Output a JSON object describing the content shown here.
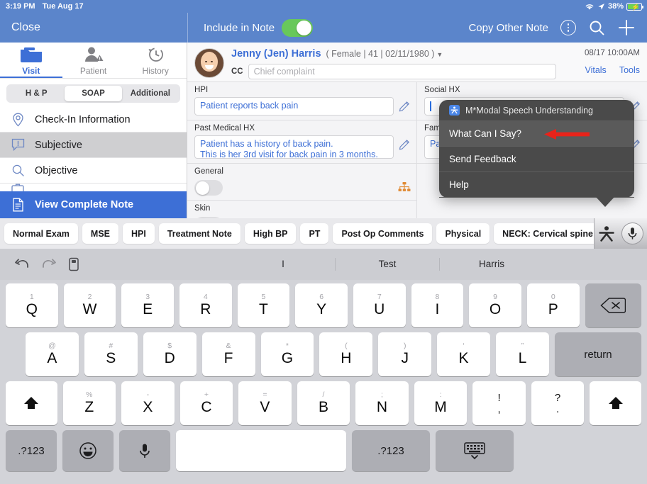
{
  "status_bar": {
    "time": "3:19 PM",
    "date": "Tue Aug 17",
    "battery_percent": "38%",
    "wifi_icon": "wifi-icon",
    "location_icon": "location-arrow-icon",
    "battery_icon": "battery-charging-icon"
  },
  "topbar": {
    "close_label": "Close",
    "include_label": "Include in Note",
    "include_toggle_on": true,
    "copy_other_note_label": "Copy Other Note",
    "more_icon": "more-vertical-circle-icon",
    "search_icon": "search-icon",
    "add_icon": "plus-icon",
    "accent_color": "#5b85cb",
    "toggle_on_color": "#68c85a"
  },
  "sidebar": {
    "tabs": [
      {
        "label": "Visit",
        "icon": "folder-icon",
        "active": true
      },
      {
        "label": "Patient",
        "icon": "person-alert-icon",
        "active": false
      },
      {
        "label": "History",
        "icon": "clock-rewind-icon",
        "active": false
      }
    ],
    "pills": [
      {
        "label": "H & P",
        "active": false
      },
      {
        "label": "SOAP",
        "active": true
      },
      {
        "label": "Additional",
        "active": false
      }
    ],
    "items": [
      {
        "label": "Check-In Information",
        "icon": "map-pin-icon",
        "state": "normal"
      },
      {
        "label": "Subjective",
        "icon": "alert-bubble-icon",
        "state": "selected"
      },
      {
        "label": "Objective",
        "icon": "magnifier-icon",
        "state": "normal"
      },
      {
        "label": "View Complete Note",
        "icon": "document-icon",
        "state": "highlighted"
      }
    ]
  },
  "patient": {
    "name": "Jenny (Jen) Harris",
    "demographics": "( Female | 41 | 02/11/1980 )",
    "caret_icon": "chevron-down-icon",
    "avatar_icon": "patient-avatar",
    "cc_label": "CC",
    "cc_value": "",
    "cc_placeholder": "Chief complaint",
    "appointment": "08/17 10:00AM",
    "vitals_label": "Vitals",
    "tools_label": "Tools"
  },
  "note_fields": {
    "left": [
      {
        "label": "HPI",
        "value": "Patient reports back pain",
        "edit_icon": "pencil-icon"
      },
      {
        "label": "Past Medical HX",
        "value": "Patient has a history of back pain.\nThis is her 3rd visit for back pain in 3 months.",
        "edit_icon": "pencil-icon"
      },
      {
        "label": "General",
        "control": "toggle-off",
        "extra_icon": "hierarchy-icon"
      },
      {
        "label": "Skin",
        "control": "toggle-off",
        "extra_icon": "hierarchy-icon"
      }
    ],
    "right": [
      {
        "label": "Social HX",
        "value": "",
        "edit_icon": "pencil-icon",
        "focused": true
      },
      {
        "label": "Family HX",
        "value": "Patient",
        "edit_icon": "pencil-icon"
      }
    ]
  },
  "popup": {
    "title": "M*Modal Speech Understanding",
    "badge_icon": "mmodal-logo-icon",
    "items": [
      {
        "label": "What Can I Say?",
        "highlighted": true
      },
      {
        "label": "Send Feedback",
        "highlighted": false
      },
      {
        "label": "Help",
        "highlighted": false
      }
    ],
    "annotation_icon": "red-arrow-annotation",
    "background_color": "#4a4a4a"
  },
  "macro_bar": {
    "buttons": [
      "Normal Exam",
      "MSE",
      "HPI",
      "Treatment Note",
      "High BP",
      "PT",
      "Post Op Comments",
      "Physical",
      "NECK: Cervical spine range of mo"
    ],
    "mmodal_icon": "mmodal-logo-icon",
    "mic_icon": "microphone-icon"
  },
  "predictive_bar": {
    "undo_icon": "undo-icon",
    "redo_icon": "redo-icon",
    "paste_icon": "clipboard-icon",
    "suggestions": [
      "I",
      "Test",
      "Harris"
    ]
  },
  "keyboard": {
    "row1": [
      {
        "alt": "1",
        "main": "Q"
      },
      {
        "alt": "2",
        "main": "W"
      },
      {
        "alt": "3",
        "main": "E"
      },
      {
        "alt": "4",
        "main": "R"
      },
      {
        "alt": "5",
        "main": "T"
      },
      {
        "alt": "6",
        "main": "Y"
      },
      {
        "alt": "7",
        "main": "U"
      },
      {
        "alt": "8",
        "main": "I"
      },
      {
        "alt": "9",
        "main": "O"
      },
      {
        "alt": "0",
        "main": "P"
      }
    ],
    "backspace_icon": "backspace-icon",
    "row2": [
      {
        "alt": "@",
        "main": "A"
      },
      {
        "alt": "#",
        "main": "S"
      },
      {
        "alt": "$",
        "main": "D"
      },
      {
        "alt": "&",
        "main": "F"
      },
      {
        "alt": "*",
        "main": "G"
      },
      {
        "alt": "(",
        "main": "H"
      },
      {
        "alt": ")",
        "main": "J"
      },
      {
        "alt": "‘",
        "main": "K"
      },
      {
        "alt": "”",
        "main": "L"
      }
    ],
    "return_label": "return",
    "row3": [
      {
        "alt": "%",
        "main": "Z"
      },
      {
        "alt": "-",
        "main": "X"
      },
      {
        "alt": "+",
        "main": "C"
      },
      {
        "alt": "=",
        "main": "V"
      },
      {
        "alt": "/",
        "main": "B"
      },
      {
        "alt": ";",
        "main": "N"
      },
      {
        "alt": ":",
        "main": "M"
      }
    ],
    "punct": [
      {
        "alt": "!",
        "main": ","
      },
      {
        "alt": "?",
        "main": "."
      }
    ],
    "shift_left_icon": "shift-arrow-icon",
    "shift_right_icon": "shift-arrow-icon",
    "numbers_label": ".?123",
    "numbers_label_right": ".?123",
    "emoji_icon": "emoji-smiley-icon",
    "dictation_icon": "microphone-icon",
    "hide_keyboard_icon": "hide-keyboard-icon",
    "space_label": ""
  }
}
